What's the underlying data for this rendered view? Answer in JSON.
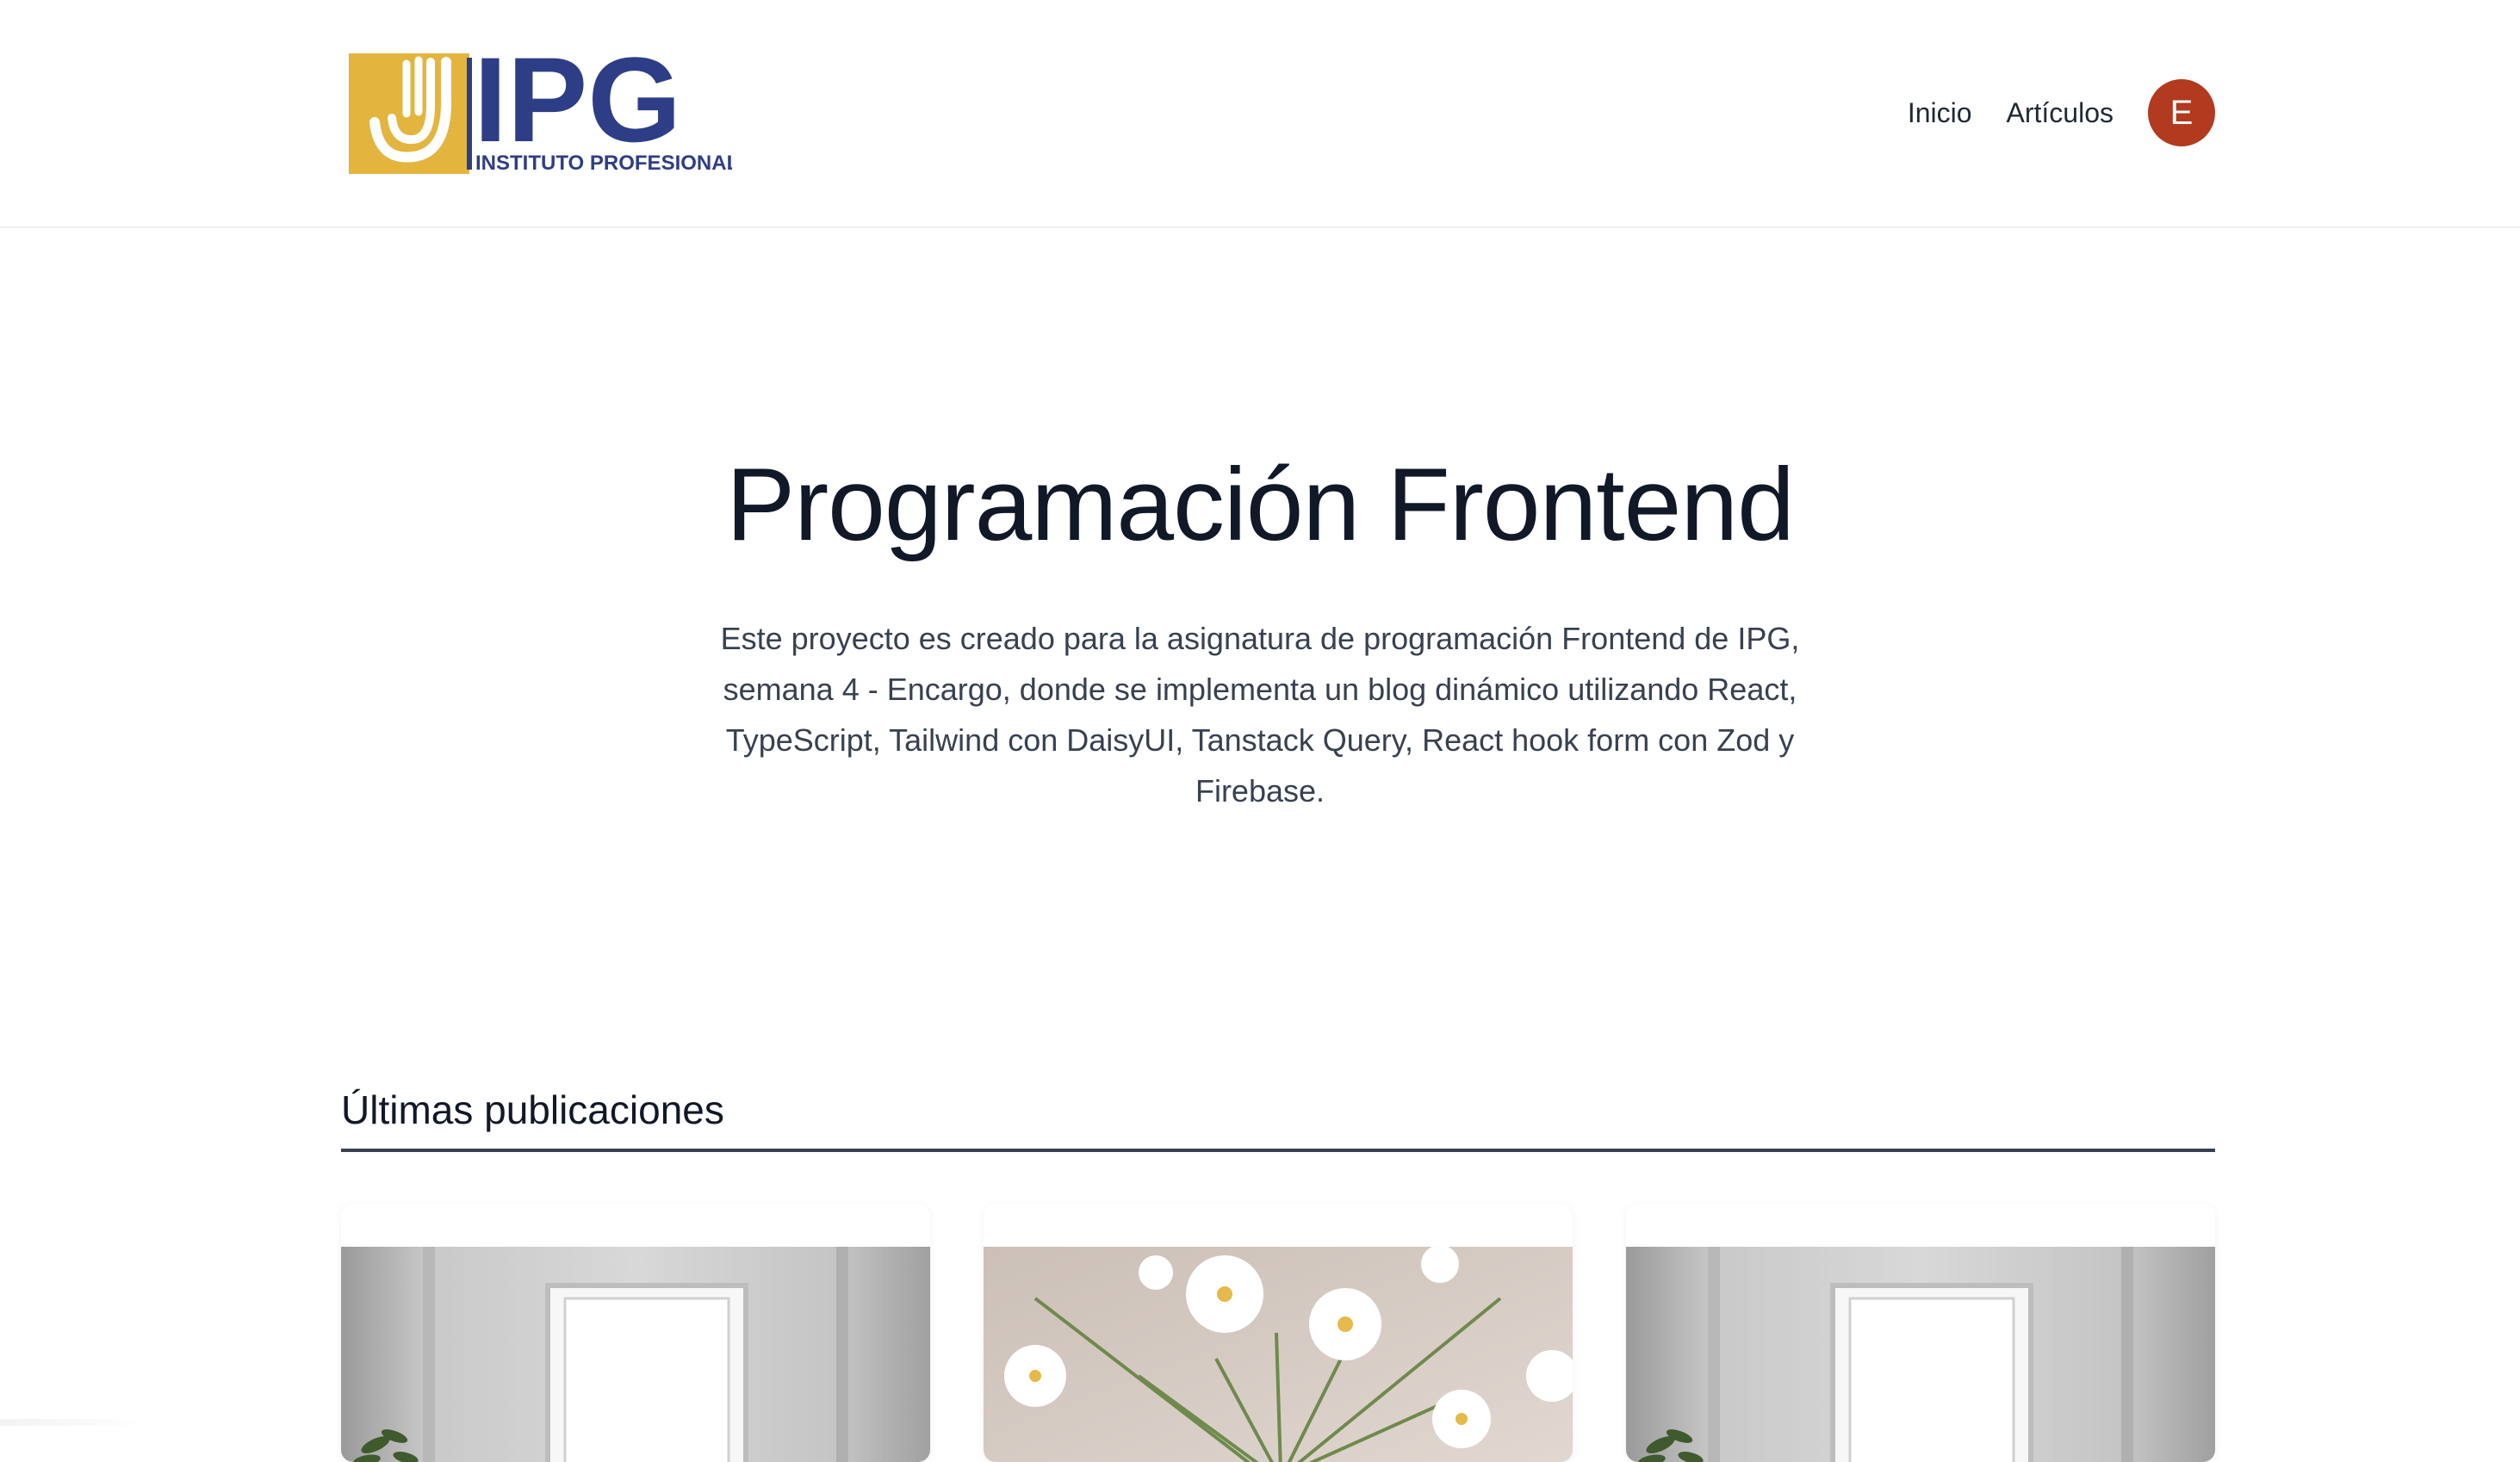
{
  "brand": {
    "logo_text": "IPG",
    "logo_subtext": "INSTITUTO PROFESIONAL",
    "colors": {
      "gold": "#e3b53f",
      "navy": "#2e3e86"
    }
  },
  "nav": {
    "items": [
      {
        "label": "Inicio"
      },
      {
        "label": "Artículos"
      }
    ],
    "avatar_initial": "E",
    "avatar_color": "#b13a1f"
  },
  "hero": {
    "title": "Programación Frontend",
    "description": "Este proyecto es creado para la asignatura de programación Frontend de IPG, semana 4 - Encargo, donde se implementa un blog dinámico utilizando React, TypeScript, Tailwind con DaisyUI, Tanstack Query, React hook form con Zod y Firebase."
  },
  "latest": {
    "title": "Últimas publicaciones",
    "cards": [
      {
        "image": "room-with-window-and-plant"
      },
      {
        "image": "white-flowers-bouquet"
      },
      {
        "image": "room-with-window-and-plant"
      }
    ]
  }
}
